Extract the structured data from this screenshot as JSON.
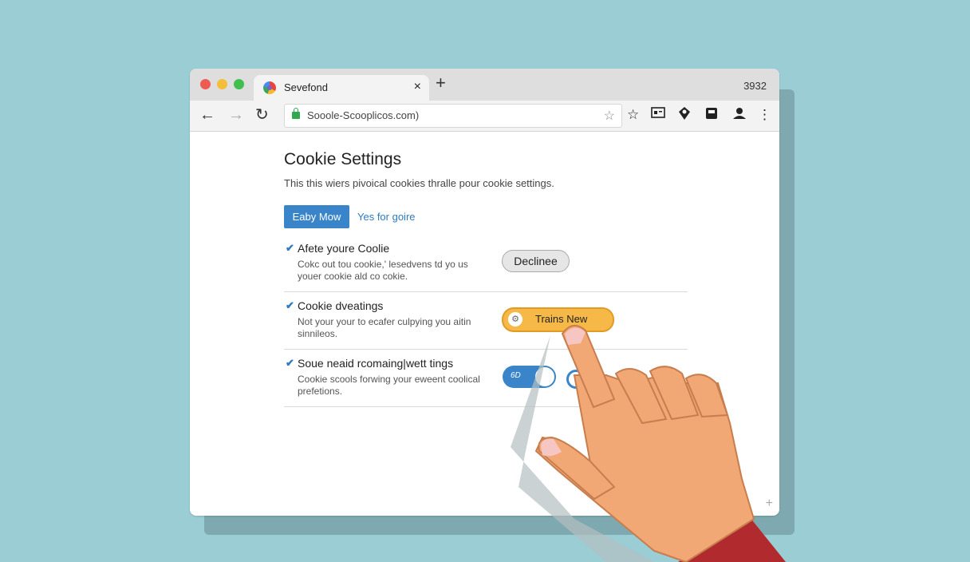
{
  "browser": {
    "tab_title": "Sevefond",
    "tab_close": "×",
    "new_tab": "+",
    "clock": "3932",
    "url": "Sooole-Scooplicos.com)",
    "icons": [
      "back-icon",
      "forward-icon",
      "reload-icon",
      "lock-icon",
      "star-icon",
      "bookmark-icon",
      "screen-icon",
      "pin-icon",
      "extension-icon",
      "profile-icon",
      "menu-icon"
    ]
  },
  "page": {
    "title": "Cookie Settings",
    "subtitle": "This this wiers pivoical cookies thralle pour cookie settings.",
    "primary_button": "Eaby Mow",
    "secondary_link": "Yes for goire",
    "rows": [
      {
        "title": "Afete youre Coolie",
        "desc": "Cokc out tou cookie,' lesedvens td yo us youer cookie ald co cokie.",
        "action": "Declinee"
      },
      {
        "title": "Cookie dveatings",
        "desc": "Not your your to ecafer culpying you aitin sinnileos.",
        "action": "Trains New"
      },
      {
        "title": "Soue neaid rcomaing|wett tings",
        "desc": "Cookie scools forwing your eweent coolical prefetions.",
        "toggle_label": "6D"
      }
    ]
  },
  "colors": {
    "background": "#9acdd4",
    "accent": "#3a85c9",
    "highlight": "#f6b947"
  }
}
